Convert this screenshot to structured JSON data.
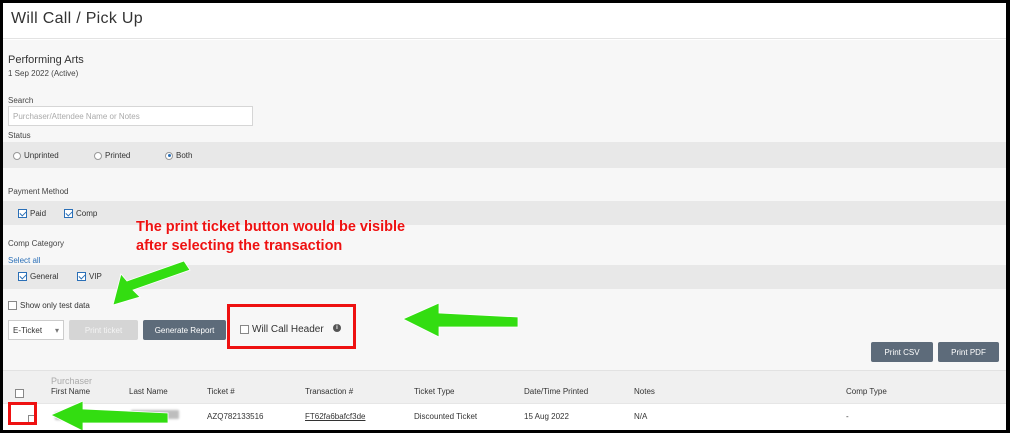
{
  "page": {
    "title": "Will Call / Pick Up"
  },
  "event": {
    "name": "Performing Arts",
    "date": "1 Sep 2022 (Active)"
  },
  "search": {
    "label": "Search",
    "placeholder": "Purchaser/Attendee Name or Notes"
  },
  "status": {
    "label": "Status",
    "options": [
      {
        "label": "Unprinted",
        "selected": false
      },
      {
        "label": "Printed",
        "selected": false
      },
      {
        "label": "Both",
        "selected": true
      }
    ]
  },
  "payment_method": {
    "label": "Payment Method",
    "options": [
      {
        "label": "Paid",
        "checked": true
      },
      {
        "label": "Comp",
        "checked": true
      }
    ]
  },
  "comp_category": {
    "label": "Comp Category",
    "select_all": "Select all",
    "options": [
      {
        "label": "General",
        "checked": true
      },
      {
        "label": "VIP",
        "checked": true
      }
    ]
  },
  "test_data": {
    "label": "Show only test data",
    "checked": false
  },
  "toolbar": {
    "ticket_type_value": "E-Ticket",
    "print_ticket_label": "Print ticket",
    "generate_report_label": "Generate Report",
    "will_call_header_label": "Will Call Header",
    "print_csv_label": "Print CSV",
    "print_pdf_label": "Print PDF"
  },
  "table": {
    "group_header": "Purchaser",
    "columns": [
      "First Name",
      "Last Name",
      "Ticket #",
      "Transaction #",
      "Ticket Type",
      "Date/Time Printed",
      "Notes",
      "Comp Type"
    ],
    "rows": [
      {
        "ticket": "AZQ782133516",
        "transaction": "FT62fa6bafcf3de",
        "ticket_type": "Discounted Ticket",
        "date_printed": "15 Aug 2022",
        "notes": "N/A",
        "comp_type": "-"
      }
    ]
  },
  "annotation": {
    "text_line1": "The print ticket button would be visible",
    "text_line2": "after selecting the transaction",
    "color": "#e11111",
    "arrow_color": "#33dd11"
  }
}
